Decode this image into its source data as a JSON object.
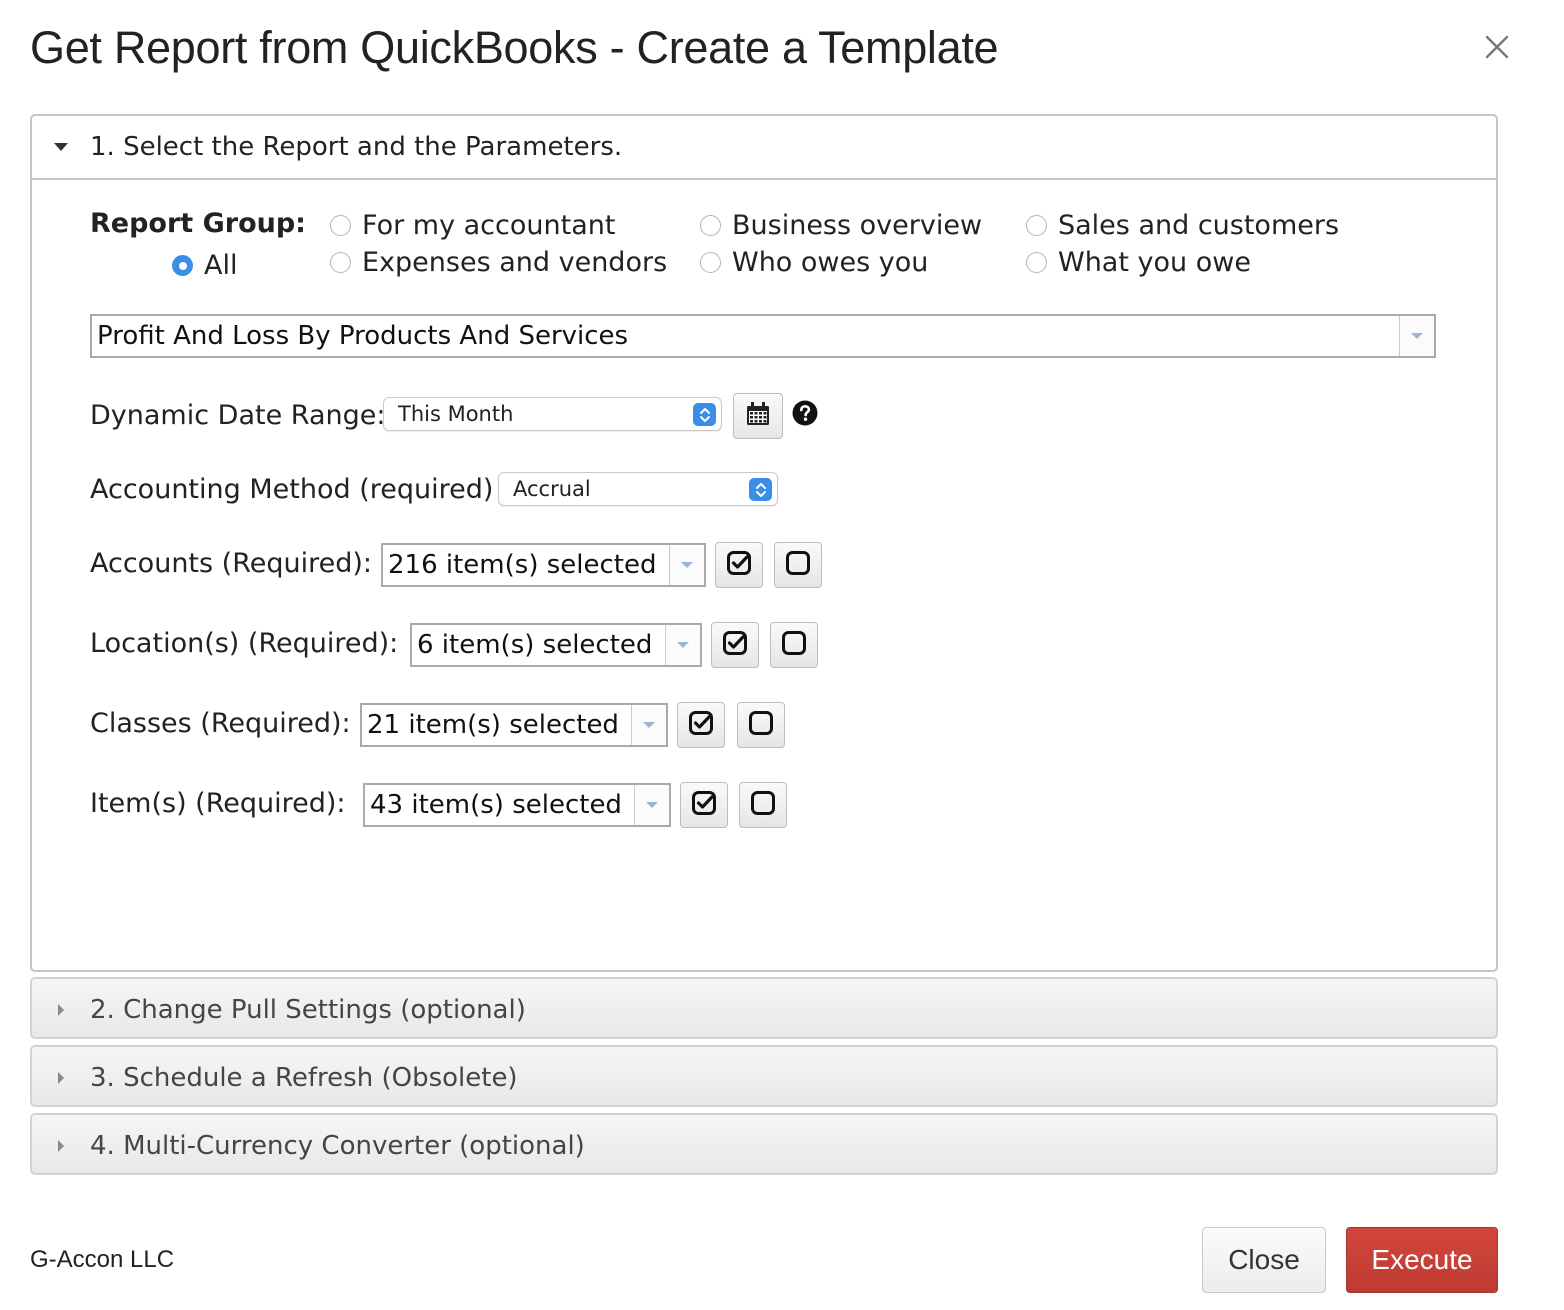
{
  "title": "Get Report from QuickBooks - Create a Template",
  "sections": [
    {
      "label": "1. Select the Report and the Parameters.",
      "expanded": true
    },
    {
      "label": "2. Change Pull Settings (optional)",
      "expanded": false
    },
    {
      "label": "3. Schedule a Refresh (Obsolete)",
      "expanded": false
    },
    {
      "label": "4. Multi-Currency Converter (optional)",
      "expanded": false
    }
  ],
  "report_group": {
    "label": "Report Group:",
    "options": [
      {
        "label": "All",
        "selected": true
      },
      {
        "label": "For my accountant",
        "selected": false
      },
      {
        "label": "Expenses and vendors",
        "selected": false
      },
      {
        "label": "Business overview",
        "selected": false
      },
      {
        "label": "Who owes you",
        "selected": false
      },
      {
        "label": "Sales and customers",
        "selected": false
      },
      {
        "label": "What you owe",
        "selected": false
      }
    ]
  },
  "report_select": {
    "value": "Profit And Loss By Products And Services"
  },
  "date_range": {
    "label": "Dynamic Date Range:",
    "value": "This Month"
  },
  "accounting_method": {
    "label": "Accounting Method (required)",
    "value": "Accrual"
  },
  "filters": [
    {
      "label": "Accounts (Required):",
      "value": "216 item(s) selected"
    },
    {
      "label": "Location(s) (Required):",
      "value": "6 item(s) selected"
    },
    {
      "label": "Classes (Required):",
      "value": "21 item(s) selected"
    },
    {
      "label": "Item(s) (Required):",
      "value": "43 item(s) selected"
    }
  ],
  "footer": {
    "brand": "G-Accon LLC",
    "close_label": "Close",
    "execute_label": "Execute"
  },
  "colors": {
    "accent": "#3a8ee6",
    "execute": "#c73f35"
  }
}
